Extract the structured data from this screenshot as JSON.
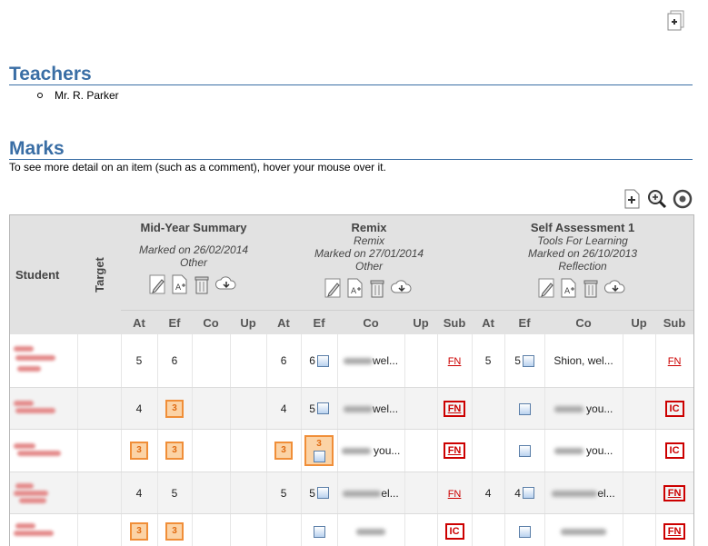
{
  "top": {
    "add_icon": "page-add-icon"
  },
  "teachers": {
    "heading": "Teachers",
    "items": [
      "Mr. R. Parker"
    ]
  },
  "marks": {
    "heading": "Marks",
    "hint": "To see more detail on an item (such as a comment), hover your mouse over it.",
    "tools": [
      "page-add-icon",
      "zoom-icon",
      "target-icon"
    ]
  },
  "grid": {
    "student_header": "Student",
    "target_header": "Target",
    "assessments": [
      {
        "title": "Mid-Year Summary",
        "subtitle": "",
        "marked": "Marked on 26/02/2014",
        "type": "Other"
      },
      {
        "title": "Remix",
        "subtitle": "Remix",
        "marked": "Marked on 27/01/2014",
        "type": "Other"
      },
      {
        "title": "Self Assessment 1",
        "subtitle": "Tools For Learning",
        "marked": "Marked on 26/10/2013",
        "type": "Reflection"
      }
    ],
    "sub_headers": [
      "At",
      "Ef",
      "Co",
      "Up",
      "At",
      "Ef",
      "Co",
      "Up",
      "Sub",
      "At",
      "Ef",
      "Co",
      "Up",
      "Sub"
    ],
    "rows": [
      [
        "5",
        "6",
        "",
        "",
        "6",
        "6 ▣",
        "wel...",
        "",
        "FN",
        "5",
        "5 ▣",
        "Shion, wel...",
        "",
        "FN"
      ],
      [
        "4",
        "3",
        "",
        "",
        "4",
        "5 ▣",
        "wel...",
        "",
        "FN",
        "",
        "▣",
        "you...",
        "",
        "IC"
      ],
      [
        "3",
        "3",
        "",
        "",
        "3",
        "3 ▣",
        "you...",
        "",
        "FN",
        "",
        "▣",
        "you...",
        "",
        "IC"
      ],
      [
        "4",
        "5",
        "",
        "",
        "5",
        "5 ▣",
        "el...",
        "",
        "FN",
        "4",
        "4 ▣",
        "el...",
        "",
        "FN"
      ],
      [
        "3",
        "3",
        "",
        "",
        "",
        "▣",
        "",
        "",
        "IC",
        "",
        "▣",
        "",
        "",
        "FN"
      ]
    ],
    "fn_label": "FN",
    "ic_label": "IC",
    "c_5": "5",
    "c_6": "6",
    "c_4": "4",
    "c_3": "3",
    "cm_wel": "wel...",
    "cm_shion": "Shion, wel...",
    "cm_you": "you...",
    "cm_el": "el..."
  }
}
